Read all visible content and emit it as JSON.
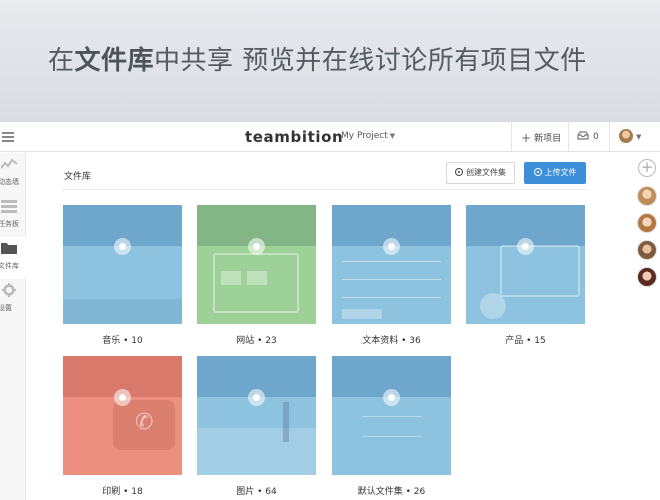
{
  "banner": {
    "pre": "在",
    "bold": "文件库",
    "post": "中共享 预览并在线讨论所有项目文件"
  },
  "topbar": {
    "brand": "teambition",
    "project": "My Project",
    "new_item": "新项目",
    "inbox_count": "0"
  },
  "sidebar": {
    "items": [
      {
        "label": "动态墙",
        "icon": "activity-icon"
      },
      {
        "label": "任务板",
        "icon": "task-board-icon"
      },
      {
        "label": "文件库",
        "icon": "folder-icon",
        "active": true
      },
      {
        "label": "设置",
        "icon": "gear-icon"
      }
    ]
  },
  "library": {
    "title": "文件库",
    "create_folder": "创建文件集",
    "upload": "上传文件",
    "folders": [
      {
        "name": "音乐 • 10",
        "color": "#8ec3e0",
        "tab": "#6fa6cc"
      },
      {
        "name": "网站 • 23",
        "color": "#9dd197",
        "tab": "#84b587"
      },
      {
        "name": "文本资料 • 36",
        "color": "#8ec3e0",
        "tab": "#6fa6cc"
      },
      {
        "name": "产品 • 15",
        "color": "#8ec3e0",
        "tab": "#6fa6cc"
      },
      {
        "name": "印刷 • 18",
        "color": "#ec8f80",
        "tab": "#d8796c"
      },
      {
        "name": "图片 • 64",
        "color": "#8ec3e0",
        "tab": "#6fa6cc"
      },
      {
        "name": "默认文件集 • 26",
        "color": "#8ec3e0",
        "tab": "#6fa6cc"
      }
    ]
  },
  "colors": {
    "accent": "#3d8fda",
    "banner_text": "#555b63"
  }
}
